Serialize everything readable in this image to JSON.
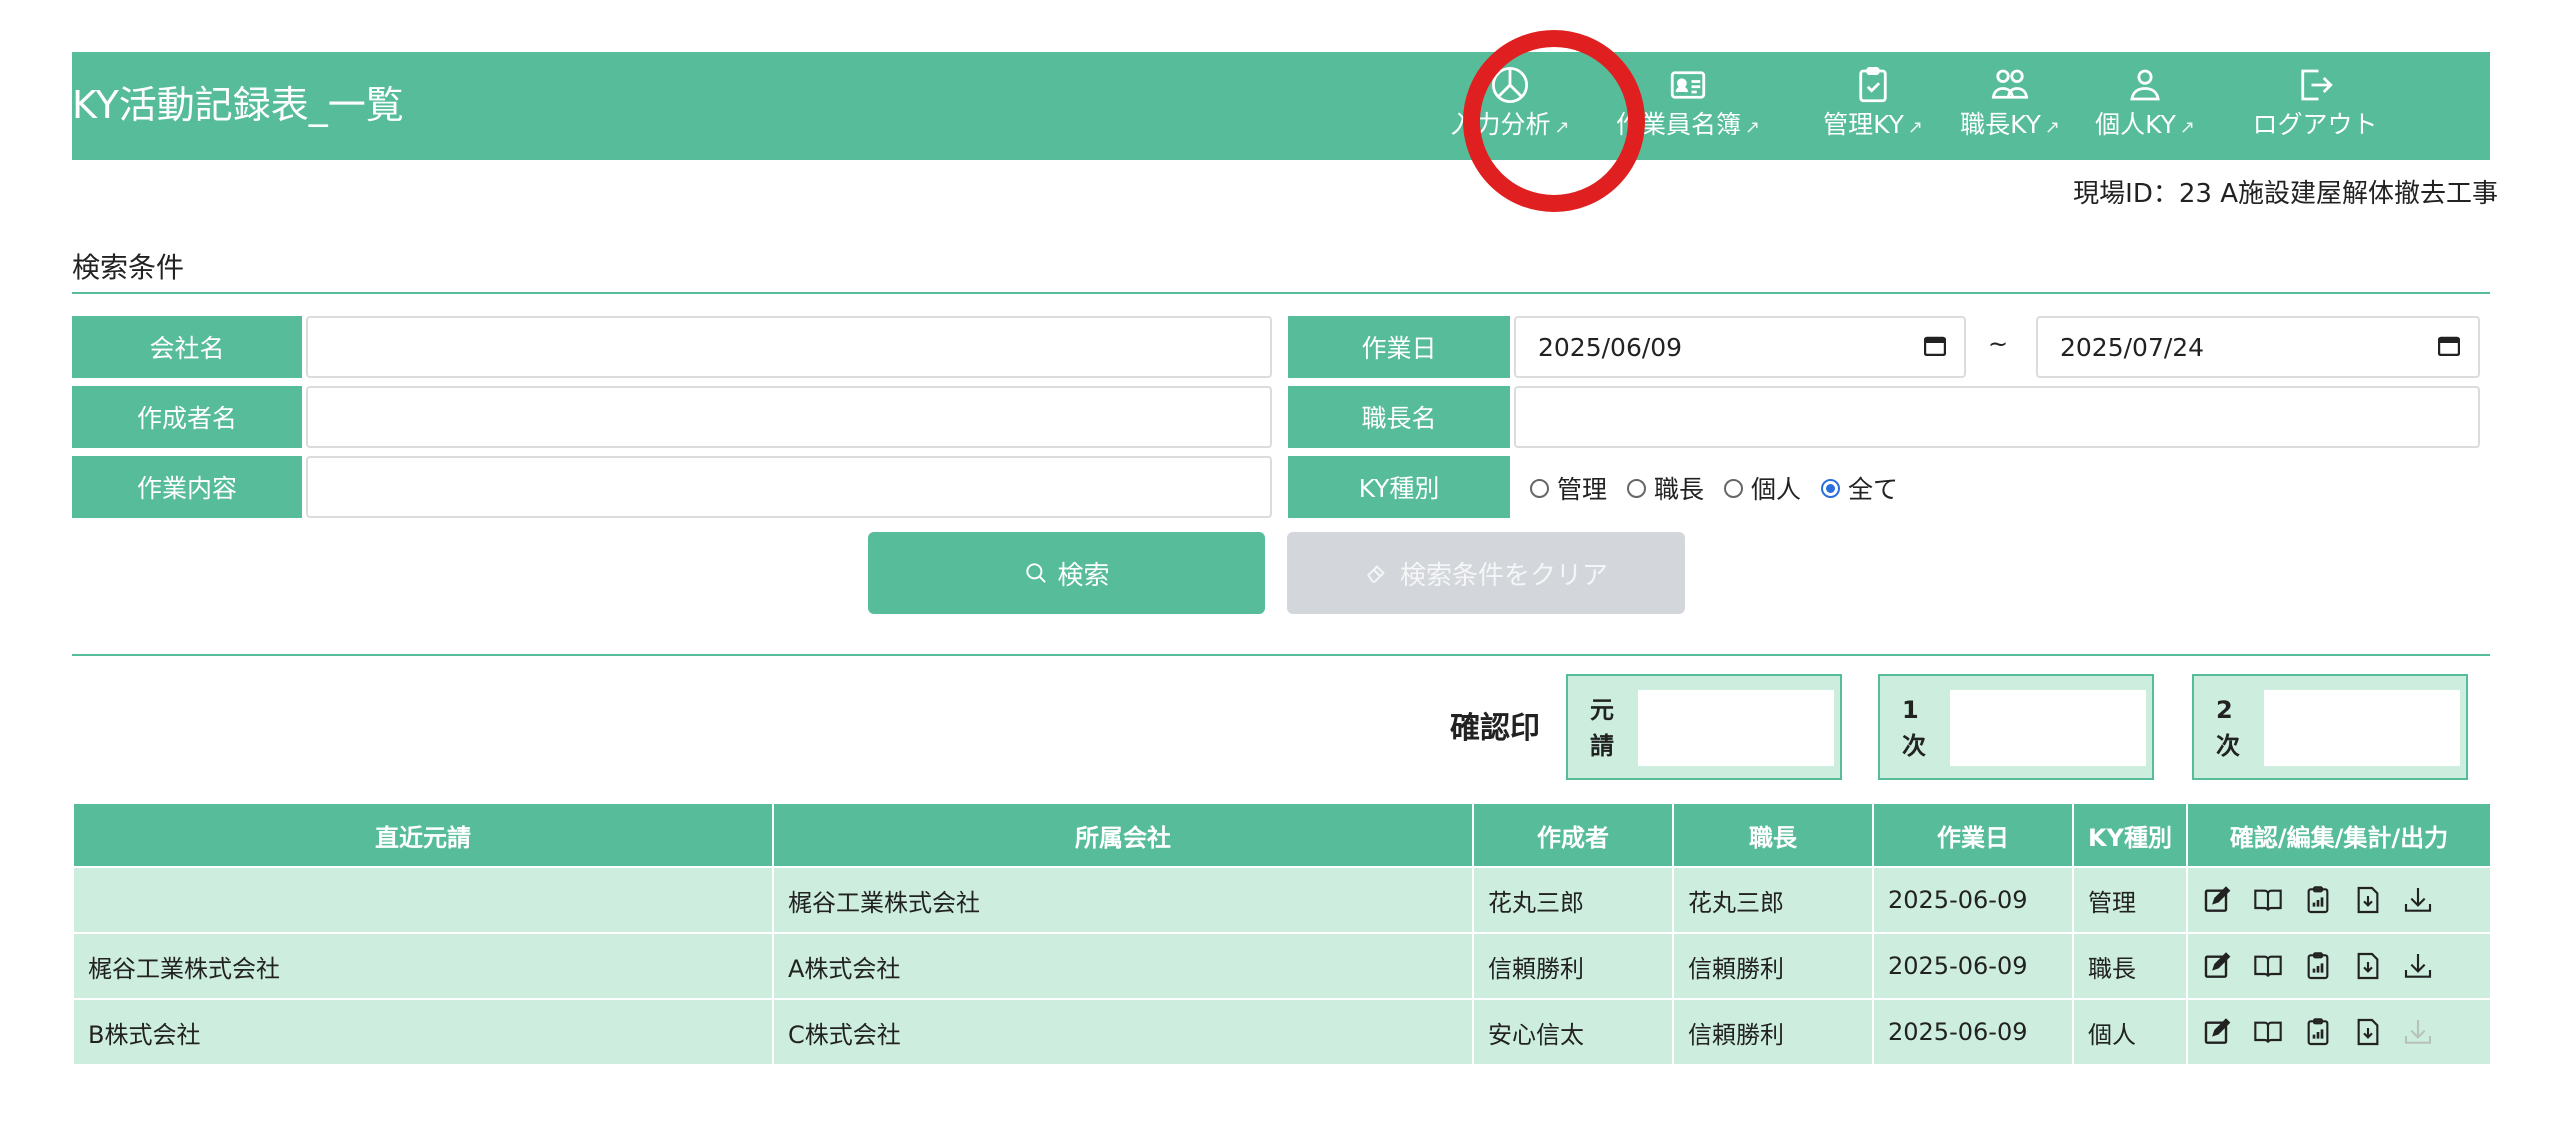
{
  "header": {
    "title": "KY活動記録表_一覧",
    "nav": [
      {
        "label": "入力分析",
        "icon": "pie-chart-icon"
      },
      {
        "label": "作業員名簿",
        "icon": "id-card-icon"
      },
      {
        "label": "管理KY",
        "icon": "clipboard-check-icon"
      },
      {
        "label": "職長KY",
        "icon": "users-icon"
      },
      {
        "label": "個人KY",
        "icon": "user-icon"
      },
      {
        "label": "ログアウト",
        "icon": "logout-icon"
      }
    ]
  },
  "site": "現場ID：23 A施設建屋解体撤去工事",
  "search": {
    "section_title": "検索条件",
    "company_label": "会社名",
    "author_label": "作成者名",
    "work_label": "作業内容",
    "date_label": "作業日",
    "date_from": "2025/06/09",
    "tilde": "~",
    "date_to": "2025/07/24",
    "foreman_label": "職長名",
    "kytype_label": "KY種別",
    "kytypes": [
      "管理",
      "職長",
      "個人",
      "全て"
    ],
    "search_button": "検索",
    "clear_button": "検索条件をクリア"
  },
  "stamps": {
    "label": "確認印",
    "boxes": [
      [
        "元",
        "請"
      ],
      [
        "1",
        "次"
      ],
      [
        "2",
        "次"
      ]
    ]
  },
  "table": {
    "headers": [
      "直近元請",
      "所属会社",
      "作成者",
      "職長",
      "作業日",
      "KY種別",
      "確認/編集/集計/出力"
    ],
    "rows": [
      [
        "",
        "梶谷工業株式会社",
        "花丸三郎",
        "花丸三郎",
        "2025-06-09",
        "管理"
      ],
      [
        "梶谷工業株式会社",
        "A株式会社",
        "信頼勝利",
        "信頼勝利",
        "2025-06-09",
        "職長"
      ],
      [
        "B株式会社",
        "C株式会社",
        "安心信太",
        "信頼勝利",
        "2025-06-09",
        "個人"
      ]
    ]
  },
  "colors": {
    "accent": "#56bc9a",
    "row_bg": "#cdeede",
    "highlight": "#e02020"
  }
}
